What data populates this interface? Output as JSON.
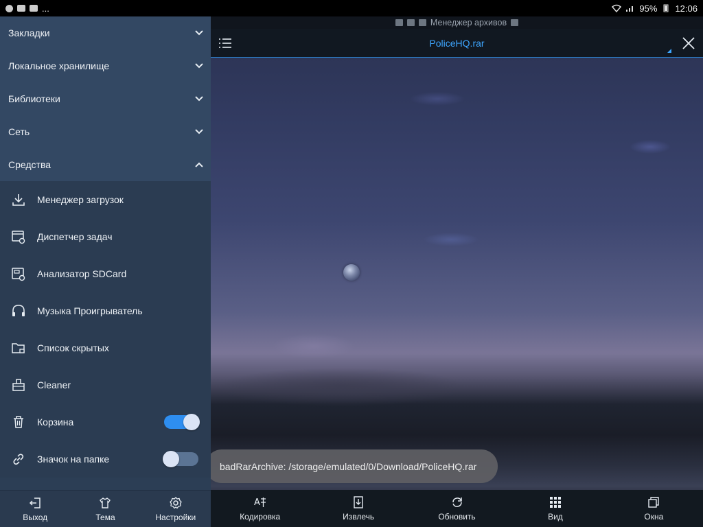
{
  "status_bar": {
    "left_overflow": "...",
    "battery": "95%",
    "time": "12:06"
  },
  "sidebar": {
    "sections": [
      {
        "label": "Закладки",
        "expanded": false
      },
      {
        "label": "Локальное хранилище",
        "expanded": false
      },
      {
        "label": "Библиотеки",
        "expanded": false
      },
      {
        "label": "Сеть",
        "expanded": false
      },
      {
        "label": "Средства",
        "expanded": true
      }
    ],
    "tools": [
      {
        "label": "Менеджер загрузок",
        "icon": "download-icon"
      },
      {
        "label": "Диспетчер задач",
        "icon": "task-manager-icon"
      },
      {
        "label": "Анализатор SDCard",
        "icon": "sd-analyzer-icon"
      },
      {
        "label": "Музыка Проигрыватель",
        "icon": "headphones-icon"
      },
      {
        "label": "Список скрытых",
        "icon": "hidden-folder-icon"
      },
      {
        "label": "Cleaner",
        "icon": "cleaner-icon"
      },
      {
        "label": "Корзина",
        "icon": "trash-icon",
        "toggle": "on"
      },
      {
        "label": "Значок на папке",
        "icon": "link-icon",
        "toggle": "off"
      }
    ],
    "bottom": [
      {
        "label": "Выход",
        "icon": "exit-icon"
      },
      {
        "label": "Тема",
        "icon": "shirt-icon"
      },
      {
        "label": "Настройки",
        "icon": "gear-icon"
      }
    ]
  },
  "main": {
    "breadcrumb": "Менеджер архивов",
    "title": "PoliceHQ.rar",
    "toast": "badRarArchive: /storage/emulated/0/Download/PoliceHQ.rar",
    "bottom": [
      {
        "label": "Кодировка",
        "icon": "encoding-icon"
      },
      {
        "label": "Извлечь",
        "icon": "extract-icon"
      },
      {
        "label": "Обновить",
        "icon": "refresh-icon"
      },
      {
        "label": "Вид",
        "icon": "grid-view-icon"
      },
      {
        "label": "Окна",
        "icon": "windows-icon"
      }
    ]
  },
  "colors": {
    "accent": "#3ea6ff",
    "sidebar_bg": "#2c3e55",
    "section_header_bg": "#334863",
    "toggle_on": "#2e8ef0",
    "toggle_off": "#5b7494"
  }
}
